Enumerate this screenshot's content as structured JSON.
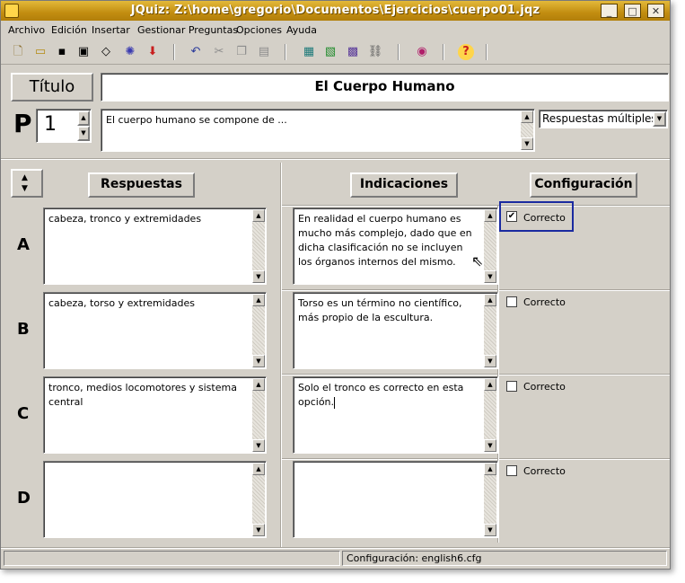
{
  "window": {
    "title": "JQuiz: Z:\\home\\gregorio\\Documentos\\Ejercicios\\cuerpo01.jqz",
    "minimize": "_",
    "maximize": "□",
    "close": "✕"
  },
  "menu": [
    {
      "label": "Archivo"
    },
    {
      "label": "Edición"
    },
    {
      "label": "Insertar"
    },
    {
      "label": "Gestionar Preguntas"
    },
    {
      "label": "Opciones"
    },
    {
      "label": "Ayuda"
    }
  ],
  "toolbar": {
    "icons": [
      "new-file-icon",
      "open-folder-icon",
      "save-icon",
      "save-as-icon",
      "eraser-icon",
      "export-web-icon",
      "down-arrow-icon",
      "undo-icon",
      "cut-icon",
      "copy-icon",
      "paste-icon",
      "grid-icon",
      "image-icon",
      "table-icon",
      "link-icon",
      "palette-icon",
      "help-icon"
    ]
  },
  "header": {
    "titulo_label": "Título",
    "titulo_value": "El Cuerpo Humano",
    "p_label": "P",
    "question_number": "1",
    "question_text": "El cuerpo humano se compone de ...",
    "question_type": "Respuestas múltiples"
  },
  "columns": {
    "answers": "Respuestas",
    "feedback": "Indicaciones",
    "config": "Configuración"
  },
  "rows": [
    {
      "letter": "A",
      "answer": "cabeza, tronco y extremidades",
      "feedback": "En realidad el cuerpo humano es mucho más complejo, dado que en dicha clasificación no se incluyen los órganos internos del mismo.",
      "correct": true,
      "correct_label": "Correcto"
    },
    {
      "letter": "B",
      "answer": "cabeza, torso y extremidades",
      "feedback": "Torso es un término no científico, más propio de la escultura.",
      "correct": false,
      "correct_label": "Correcto"
    },
    {
      "letter": "C",
      "answer": "tronco, medios locomotores y sistema central",
      "feedback": "Solo el tronco es correcto en esta opción.",
      "correct": false,
      "correct_label": "Correcto"
    },
    {
      "letter": "D",
      "answer": "",
      "feedback": "",
      "correct": false,
      "correct_label": "Correcto"
    }
  ],
  "status": {
    "left": "",
    "config": "Configuración: english6.cfg"
  },
  "colors": {
    "title_bar": "#c28d10",
    "focus_border": "#1a2aa0",
    "face": "#d4d0c8"
  }
}
